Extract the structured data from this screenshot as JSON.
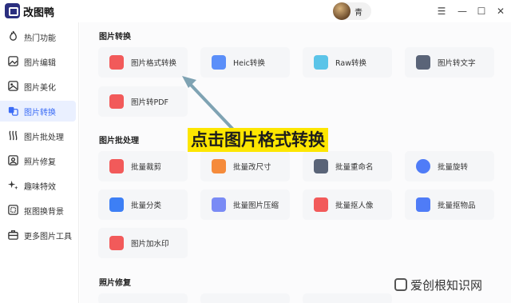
{
  "app": {
    "title": "改图鸭",
    "username": "青"
  },
  "window_controls": {
    "menu": "☰",
    "minimize": "—",
    "maximize": "☐",
    "close": "✕"
  },
  "sidebar": {
    "items": [
      {
        "label": "热门功能",
        "icon": "flame-icon"
      },
      {
        "label": "图片编辑",
        "icon": "image-edit-icon"
      },
      {
        "label": "图片美化",
        "icon": "image-beautify-icon"
      },
      {
        "label": "图片转换",
        "icon": "image-convert-icon",
        "active": true
      },
      {
        "label": "图片批处理",
        "icon": "batch-icon"
      },
      {
        "label": "照片修复",
        "icon": "photo-repair-icon"
      },
      {
        "label": "趣味特效",
        "icon": "sparkle-icon"
      },
      {
        "label": "抠图换背景",
        "icon": "cutout-icon"
      },
      {
        "label": "更多图片工具",
        "icon": "toolbox-icon"
      }
    ]
  },
  "sections": {
    "convert": {
      "title": "图片转换",
      "items": [
        {
          "label": "图片格式转换",
          "color": "#f25a5a"
        },
        {
          "label": "Heic转换",
          "color": "#5b8ff9"
        },
        {
          "label": "Raw转换",
          "color": "#5bc4e8"
        },
        {
          "label": "图片转文字",
          "color": "#5a6478"
        },
        {
          "label": "图片转PDF",
          "color": "#f25a5a"
        }
      ]
    },
    "batch": {
      "title": "图片批处理",
      "items": [
        {
          "label": "批量裁剪",
          "color": "#f25a5a"
        },
        {
          "label": "批量改尺寸",
          "color": "#f58b3b"
        },
        {
          "label": "批量重命名",
          "color": "#5a6478"
        },
        {
          "label": "批量旋转",
          "color": "#4f7cf7"
        },
        {
          "label": "批量分类",
          "color": "#3d7ff5"
        },
        {
          "label": "批量图片压缩",
          "color": "#7a8bf5"
        },
        {
          "label": "批量抠人像",
          "color": "#f25a5a"
        },
        {
          "label": "批量抠物品",
          "color": "#4f7cf7"
        },
        {
          "label": "图片加水印",
          "color": "#f25a5a"
        }
      ]
    },
    "repair": {
      "title": "照片修复"
    }
  },
  "annotation": {
    "text": "点击图片格式转换",
    "background": "#fde600"
  },
  "watermark": {
    "text": "爱创根知识网"
  }
}
